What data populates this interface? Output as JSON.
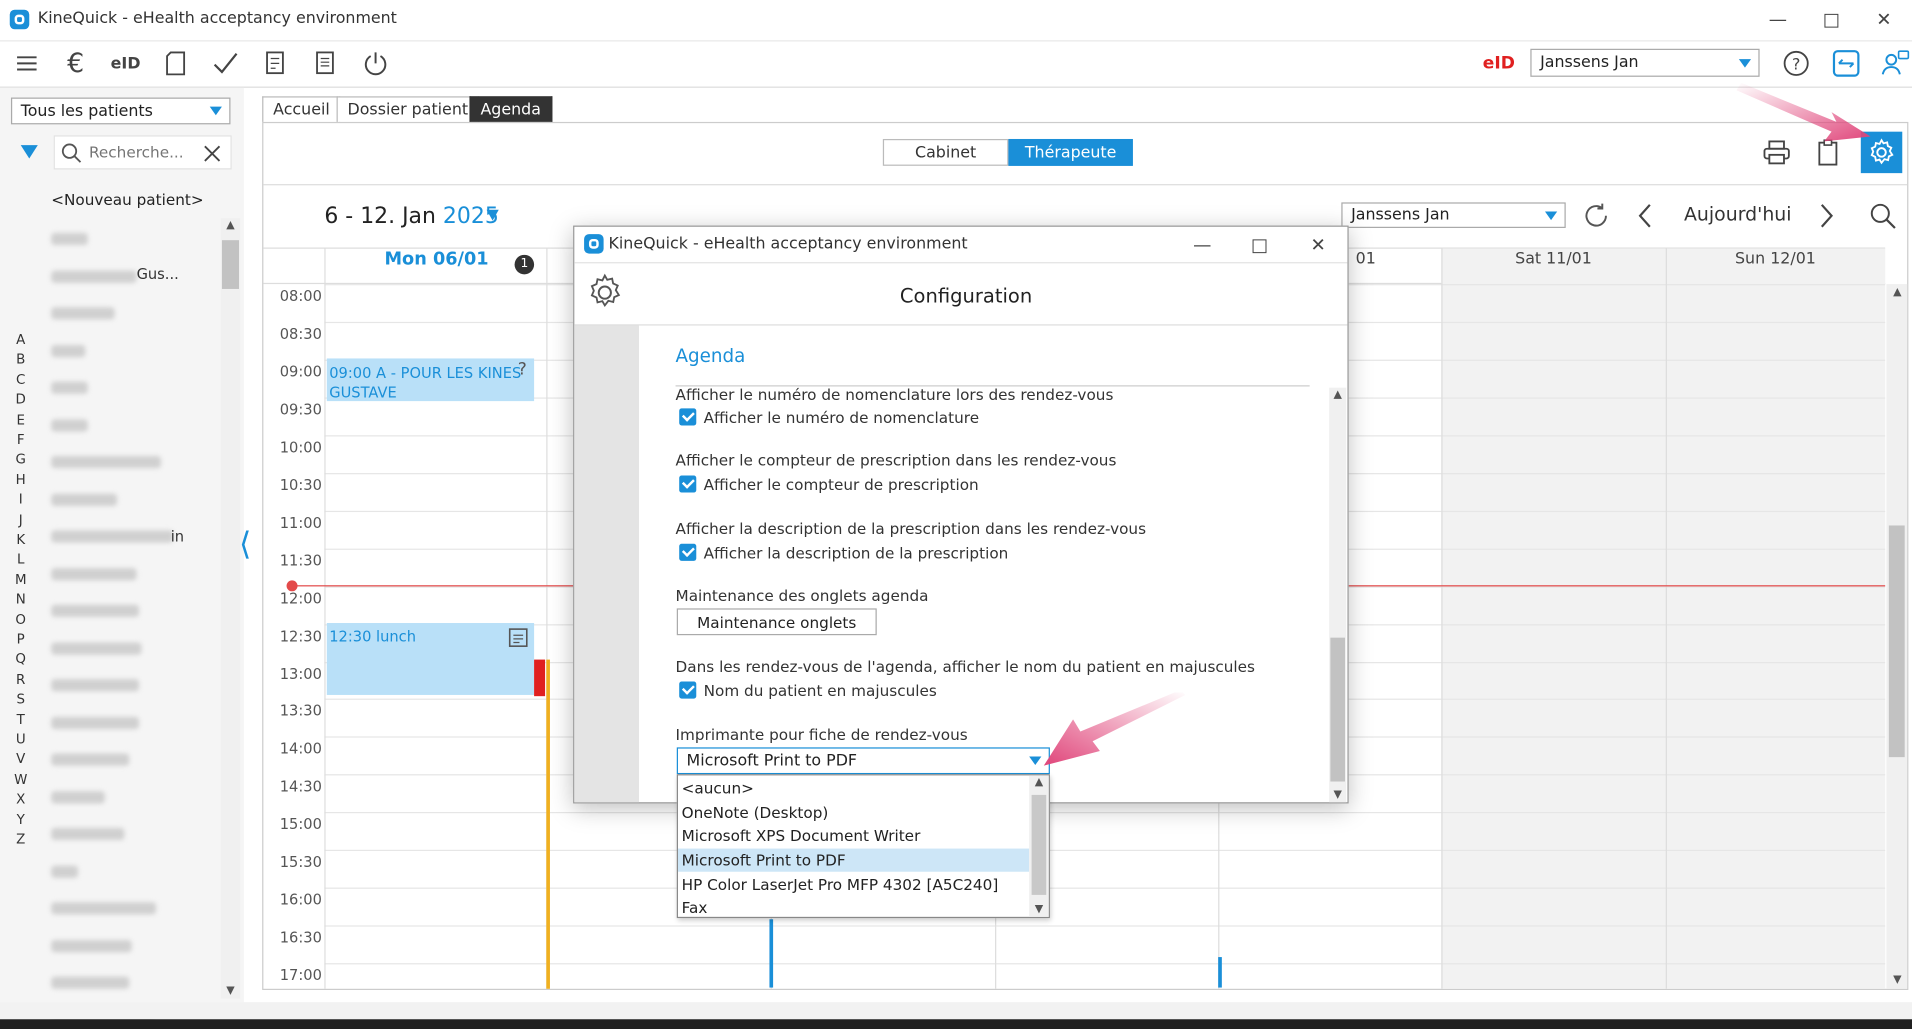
{
  "window": {
    "title": "KineQuick - eHealth acceptancy environment"
  },
  "toolbar": {
    "eid_label": "eID",
    "user_select": "Janssens Jan"
  },
  "left": {
    "patient_filter": "Tous les patients",
    "search_placeholder": "Recherche...",
    "new_patient": "<Nouveau patient>",
    "alphabet": [
      "A",
      "B",
      "C",
      "D",
      "E",
      "F",
      "G",
      "H",
      "I",
      "J",
      "K",
      "L",
      "M",
      "N",
      "O",
      "P",
      "Q",
      "R",
      "S",
      "T",
      "U",
      "V",
      "W",
      "X",
      "Y",
      "Z"
    ],
    "visible_fragments": {
      "gus": "Gus...",
      "in": "in"
    }
  },
  "tabs": [
    "Accueil",
    "Dossier patient",
    "Agenda"
  ],
  "agenda": {
    "view_toggle": [
      "Cabinet",
      "Thérapeute"
    ],
    "range": "6 - 12. Jan",
    "year": "2025",
    "therapist_select": "Janssens Jan",
    "today_label": "Aujourd'hui",
    "days": [
      {
        "label": "Mon 06/01",
        "badge": "1"
      },
      {
        "label": "01"
      },
      {
        "label": "Sat 11/01"
      },
      {
        "label": "Sun 12/01"
      }
    ],
    "times": [
      "08:00",
      "08:30",
      "09:00",
      "09:30",
      "10:00",
      "10:30",
      "11:00",
      "11:30",
      "12:00",
      "12:30",
      "13:00",
      "13:30",
      "14:00",
      "14:30",
      "15:00",
      "15:30",
      "16:00",
      "16:30",
      "17:00"
    ],
    "events": [
      {
        "text": "09:00 A - POUR LES KINES GUSTAVE",
        "help": "?"
      },
      {
        "text": "12:30 lunch"
      }
    ]
  },
  "dialog": {
    "title": "KineQuick - eHealth acceptancy environment",
    "heading": "Configuration",
    "section": "Agenda",
    "settings": [
      {
        "label": "Afficher le numéro de nomenclature lors des rendez-vous",
        "checkbox": "Afficher le numéro de nomenclature",
        "checked": true
      },
      {
        "label": "Afficher le compteur de prescription dans les rendez-vous",
        "checkbox": "Afficher le compteur de prescription",
        "checked": true
      },
      {
        "label": "Afficher la description de la prescription dans les rendez-vous",
        "checkbox": "Afficher la description de la prescription",
        "checked": true
      },
      {
        "label": "Maintenance des onglets agenda",
        "button": "Maintenance onglets"
      },
      {
        "label": "Dans les rendez-vous de l'agenda, afficher le nom du patient en majuscules",
        "checkbox": "Nom du patient en majuscules",
        "checked": true
      },
      {
        "label": "Imprimante pour fiche de rendez-vous",
        "select": "Microsoft Print to PDF"
      }
    ],
    "printer_options": [
      "<aucun>",
      "OneNote (Desktop)",
      "Microsoft XPS Document Writer",
      "Microsoft Print to PDF",
      "HP Color LaserJet Pro MFP 4302 [A5C240]",
      "Fax"
    ],
    "printer_selected_index": 3
  },
  "colors": {
    "accent": "#1a8fd8",
    "event_bg": "#b9e0f8",
    "now_line": "#e34a4a",
    "annotation_arrow": "#e0457a",
    "eid_red": "#e02020"
  },
  "icons": [
    "menu-icon",
    "euro-icon",
    "eid-card-icon",
    "document-icon",
    "check-icon",
    "invoice-icon",
    "list-document-icon",
    "power-icon",
    "help-icon",
    "sync-icon",
    "chat-user-icon",
    "print-icon",
    "clipboard-icon",
    "gear-icon",
    "refresh-icon",
    "chevron-left-icon",
    "chevron-right-icon",
    "search-icon",
    "filter-icon",
    "close-icon"
  ]
}
